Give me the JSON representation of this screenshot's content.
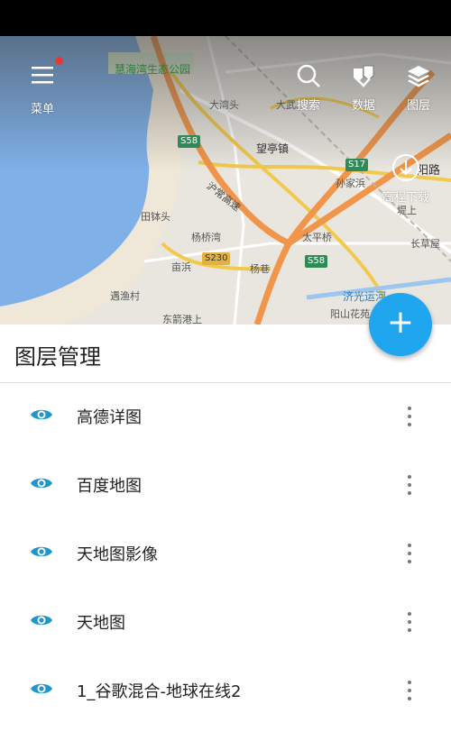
{
  "map": {
    "labels": {
      "park": "慧海湾生态公园",
      "dawantou": "大湾头",
      "dawu": "大武",
      "wangting": "望亭镇",
      "sunjiabin": "孙家浜",
      "hujiang": "沪常高速",
      "tianjiatou": "田钵头",
      "yangqiaowan": "杨桥湾",
      "taipingqiao": "太平桥",
      "dibang": "堤上",
      "changcaowu": "长草屋",
      "zhoubang": "亩浜",
      "yangxiang": "杨巷",
      "yuyucun": "遇渔村",
      "dongqian": "东箭港上",
      "jiguang": "济光运河",
      "yangshan": "阳山花苑",
      "yanglu": "阳路"
    },
    "road_signs": [
      "S58",
      "S17",
      "S230",
      "S58"
    ]
  },
  "toolbar": {
    "menu_label": "菜单",
    "search_label": "搜索",
    "data_label": "数据",
    "layers_label": "图层",
    "download_label": "高程下载",
    "fab_symbol": "+"
  },
  "panel": {
    "title": "图层管理",
    "layers": [
      {
        "name": "高德详图"
      },
      {
        "name": "百度地图"
      },
      {
        "name": "天地图影像"
      },
      {
        "name": "天地图"
      },
      {
        "name": "1_谷歌混合-地球在线2"
      }
    ]
  },
  "colors": {
    "accent": "#1fa6ee",
    "eye_icon": "#2196c9",
    "notification_dot": "#e53935"
  }
}
